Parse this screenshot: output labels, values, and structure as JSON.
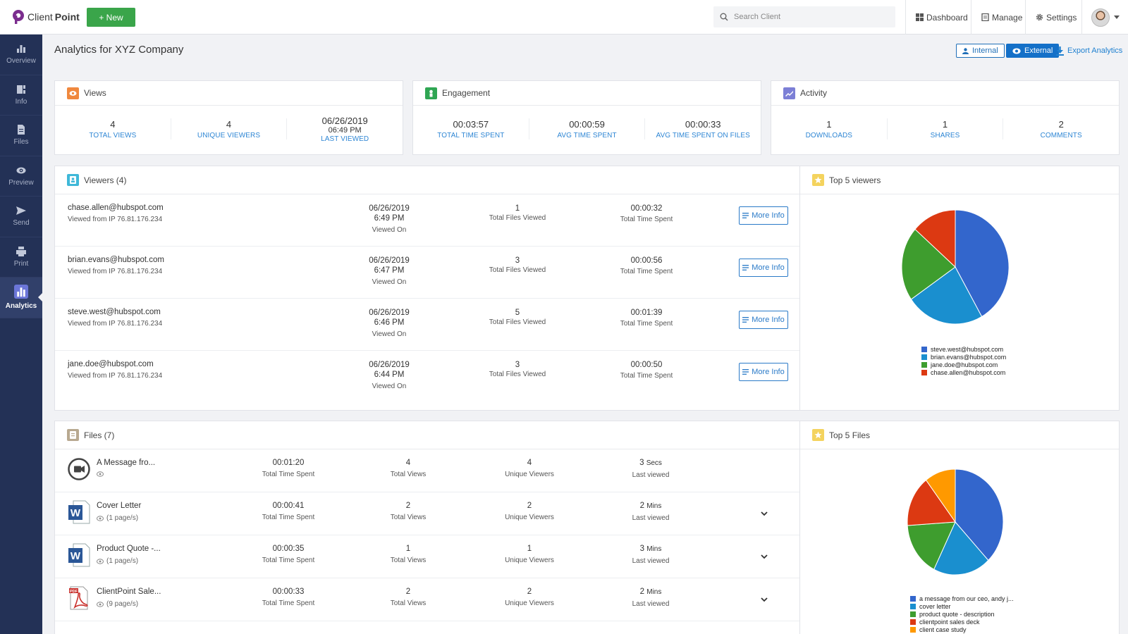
{
  "app": {
    "logo_text_light": "Client",
    "logo_text_bold": "Point",
    "new_button": "+ New"
  },
  "search": {
    "placeholder": "Search Client"
  },
  "topnav": {
    "dashboard": "Dashboard",
    "manage": "Manage",
    "settings": "Settings"
  },
  "sidebar": {
    "items": [
      {
        "label": "Overview",
        "icon": "bar-chart-icon"
      },
      {
        "label": "Info",
        "icon": "info-icon"
      },
      {
        "label": "Files",
        "icon": "file-icon"
      },
      {
        "label": "Preview",
        "icon": "eye-icon"
      },
      {
        "label": "Send",
        "icon": "send-icon"
      },
      {
        "label": "Print",
        "icon": "print-icon"
      },
      {
        "label": "Analytics",
        "icon": "analytics-icon",
        "active": true
      }
    ]
  },
  "header": {
    "title": "Analytics for XYZ Company",
    "internal": "Internal",
    "external": "External",
    "export": "Export Analytics"
  },
  "views": {
    "title": "Views",
    "total_views": "4",
    "total_views_label": "TOTAL VIEWS",
    "unique_viewers": "4",
    "unique_viewers_label": "UNIQUE VIEWERS",
    "last_viewed_date": "06/26/2019",
    "last_viewed_time": "06:49 PM",
    "last_viewed_label": "LAST VIEWED"
  },
  "engagement": {
    "title": "Engagement",
    "total_time": "00:03:57",
    "total_time_label": "TOTAL TIME SPENT",
    "avg_time": "00:00:59",
    "avg_time_label": "AVG TIME SPENT",
    "avg_files": "00:00:33",
    "avg_files_label": "AVG TIME SPENT ON FILES"
  },
  "activity": {
    "title": "Activity",
    "downloads": "1",
    "downloads_label": "DOWNLOADS",
    "shares": "1",
    "shares_label": "SHARES",
    "comments": "2",
    "comments_label": "COMMENTS"
  },
  "viewers": {
    "title": "Viewers (4)",
    "more_info": "More Info",
    "viewed_on_label": "Viewed On",
    "files_label": "Total Files Viewed",
    "time_label": "Total Time Spent",
    "rows": [
      {
        "email": "chase.allen@hubspot.com",
        "ip": "Viewed from IP 76.81.176.234",
        "date": "06/26/2019",
        "time": "6:49 PM",
        "files": "1",
        "spent": "00:00:32"
      },
      {
        "email": "brian.evans@hubspot.com",
        "ip": "Viewed from IP 76.81.176.234",
        "date": "06/26/2019",
        "time": "6:47 PM",
        "files": "3",
        "spent": "00:00:56"
      },
      {
        "email": "steve.west@hubspot.com",
        "ip": "Viewed from IP 76.81.176.234",
        "date": "06/26/2019",
        "time": "6:46 PM",
        "files": "5",
        "spent": "00:01:39"
      },
      {
        "email": "jane.doe@hubspot.com",
        "ip": "Viewed from IP 76.81.176.234",
        "date": "06/26/2019",
        "time": "6:44 PM",
        "files": "3",
        "spent": "00:00:50"
      }
    ]
  },
  "top_viewers": {
    "title": "Top 5 viewers",
    "legend": [
      "steve.west@hubspot.com",
      "brian.evans@hubspot.com",
      "jane.doe@hubspot.com",
      "chase.allen@hubspot.com"
    ],
    "colors": [
      "#3366cc",
      "#1a8fcf",
      "#3e9d2e",
      "#dc3912"
    ]
  },
  "files": {
    "title": "Files (7)",
    "time_label": "Total Time Spent",
    "views_label": "Total Views",
    "unique_label": "Unique Viewers",
    "last_label": "Last viewed",
    "rows": [
      {
        "name": "A Message fro...",
        "meta": "",
        "icon": "video-icon",
        "time": "00:01:20",
        "views": "4",
        "unique": "4",
        "last_num": "3",
        "last_unit": "Secs",
        "expand": false
      },
      {
        "name": "Cover Letter",
        "meta": "(1 page/s)",
        "icon": "word-doc-icon",
        "time": "00:00:41",
        "views": "2",
        "unique": "2",
        "last_num": "2",
        "last_unit": "Mins",
        "expand": true
      },
      {
        "name": "Product Quote -...",
        "meta": "(1 page/s)",
        "icon": "word-doc-icon",
        "time": "00:00:35",
        "views": "1",
        "unique": "1",
        "last_num": "3",
        "last_unit": "Mins",
        "expand": true
      },
      {
        "name": "ClientPoint Sale...",
        "meta": "(9 page/s)",
        "icon": "pdf-icon",
        "time": "00:00:33",
        "views": "2",
        "unique": "2",
        "last_num": "2",
        "last_unit": "Mins",
        "expand": true
      }
    ]
  },
  "top_files": {
    "title": "Top 5 Files",
    "legend": [
      "a message from our ceo, andy j...",
      "cover letter",
      "product quote - description",
      "clientpoint sales deck",
      "client case study"
    ],
    "colors": [
      "#3366cc",
      "#1a8fcf",
      "#3e9d2e",
      "#dc3912",
      "#ff9900"
    ]
  },
  "chart_data": [
    {
      "type": "pie",
      "title": "Top 5 viewers",
      "categories": [
        "steve.west@hubspot.com",
        "brian.evans@hubspot.com",
        "jane.doe@hubspot.com",
        "chase.allen@hubspot.com"
      ],
      "values": [
        99,
        56,
        50,
        32
      ]
    },
    {
      "type": "pie",
      "title": "Top 5 Files",
      "categories": [
        "a message from our ceo, andy j...",
        "cover letter",
        "product quote - description",
        "clientpoint sales deck",
        "client case study"
      ],
      "values": [
        80,
        41,
        35,
        33,
        22
      ]
    }
  ]
}
